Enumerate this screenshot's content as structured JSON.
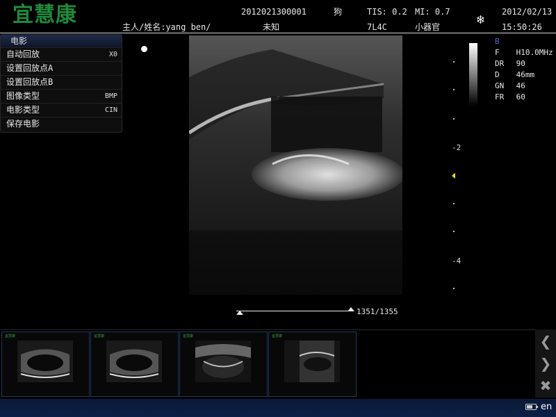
{
  "header": {
    "logo": "宜慧康",
    "patient_id": "2012021300001",
    "species": "狗",
    "tis": "TIS: 0.2",
    "mi": "MI: 0.7",
    "date": "2012/02/13",
    "owner_name": "主人/姓名:yang ben/",
    "breed": "未知",
    "probe": "7L4C",
    "preset": "小器官",
    "time": "15:50:26"
  },
  "menu": {
    "title": "电影",
    "items": [
      {
        "label": "自动回放",
        "value": "X0"
      },
      {
        "label": "设置回放点A",
        "value": ""
      },
      {
        "label": "设置回放点B",
        "value": ""
      },
      {
        "label": "图像类型",
        "value": "BMP"
      },
      {
        "label": "电影类型",
        "value": "CIN"
      },
      {
        "label": "保存电影",
        "value": ""
      }
    ]
  },
  "scale": {
    "label_2": "-2",
    "label_4": "-4"
  },
  "params": {
    "mode": "B",
    "rows": [
      {
        "k": "F",
        "v": "H10.0MHz"
      },
      {
        "k": "DR",
        "v": "90"
      },
      {
        "k": "D",
        "v": "46mm"
      },
      {
        "k": "GN",
        "v": "46"
      },
      {
        "k": "FR",
        "v": "60"
      }
    ]
  },
  "cine": {
    "frame": "1351/1355",
    "current": 1351,
    "total": 1355
  },
  "icons": {
    "freeze": "snowflake-icon",
    "prev": "chevron-left-icon",
    "next": "chevron-right-icon",
    "close": "close-icon",
    "battery": "battery-icon"
  },
  "status": {
    "language": "en"
  },
  "colors": {
    "logo": "#1e8a3a",
    "bottom_bar": "#0a1a38",
    "marker": "#e6e000",
    "mode": "#4a6ad8"
  }
}
